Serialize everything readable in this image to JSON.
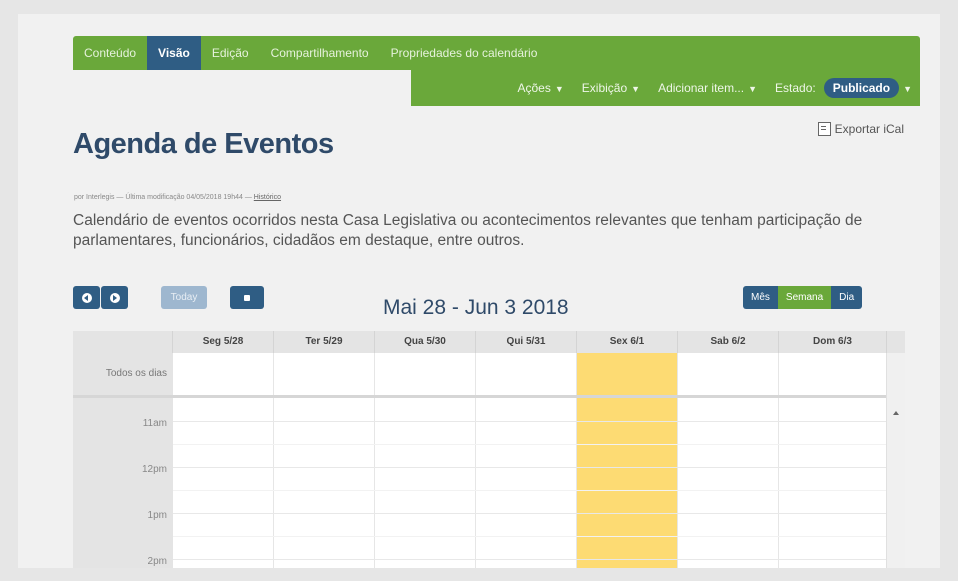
{
  "tabs": [
    {
      "label": "Conteúdo"
    },
    {
      "label": "Visão"
    },
    {
      "label": "Edição"
    },
    {
      "label": "Compartilhamento"
    },
    {
      "label": "Propriedades do calendário"
    }
  ],
  "subbar": {
    "actions": "Ações",
    "display": "Exibição",
    "add_item": "Adicionar item...",
    "status_label": "Estado:",
    "status_value": "Publicado"
  },
  "export_label": "Exportar iCal",
  "page": {
    "title": "Agenda de Eventos",
    "byline": "por Interlegis — Última modificação 04/05/2018 19h44 —",
    "history_link": "Histórico",
    "description": "Calendário de eventos ocorridos nesta Casa Legislativa ou acontecimentos relevantes que tenham participação de parlamentares, funcionários, cidadãos em destaque, entre outros."
  },
  "calendar": {
    "today_button": "Today",
    "range_title": "Mai 28 - Jun 3 2018",
    "views": [
      "Mês",
      "Semana",
      "Dia"
    ],
    "active_view": "Semana",
    "days": [
      "Seg 5/28",
      "Ter 5/29",
      "Qua 5/30",
      "Qui 5/31",
      "Sex 6/1",
      "Sab 6/2",
      "Dom 6/3"
    ],
    "highlighted_day": "Sex 6/1",
    "all_day_label": "Todos os dias",
    "hours": [
      "11am",
      "12pm",
      "1pm",
      "2pm"
    ]
  },
  "colors": {
    "accent_green": "#6aa83a",
    "accent_blue": "#2f5d84",
    "today_highlight": "#fddb73"
  },
  "icons": {
    "prev": "chevron-left-icon",
    "next": "chevron-right-icon",
    "calendar_picker": "calendar-icon",
    "export": "export-icon"
  }
}
